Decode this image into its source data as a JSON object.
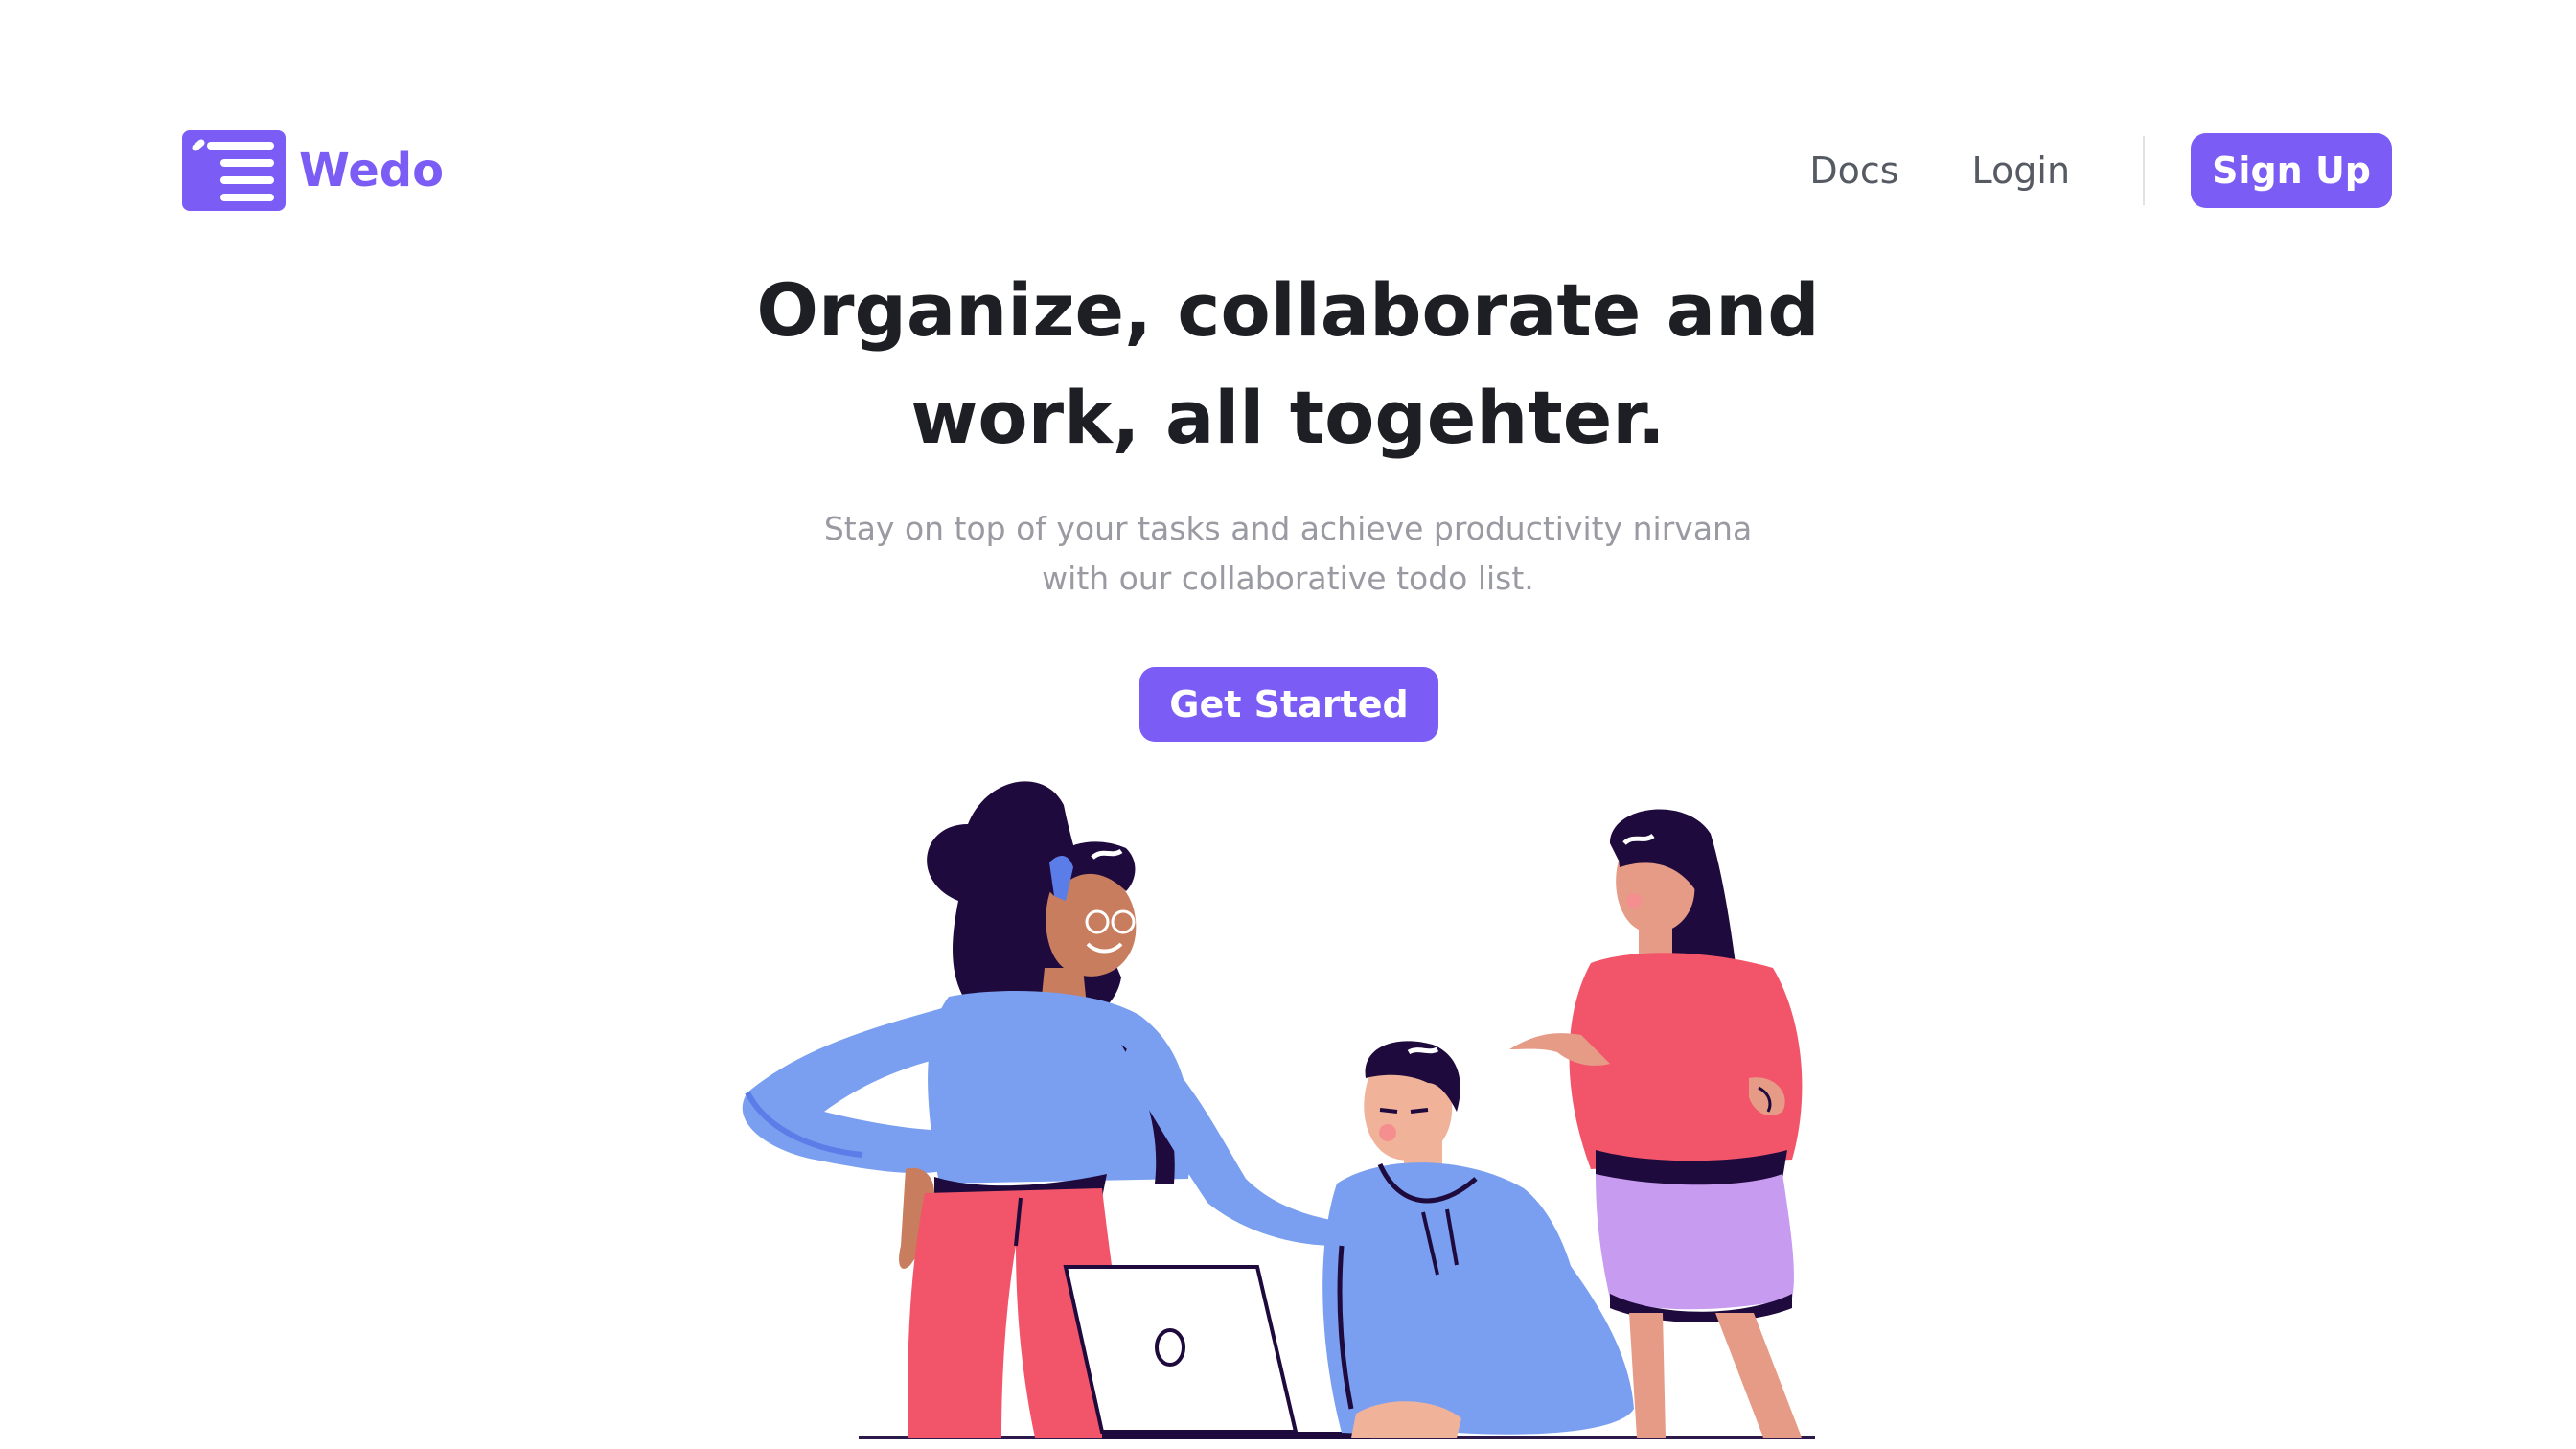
{
  "brand": {
    "name": "Wedo",
    "accent": "#7b5cf5"
  },
  "nav": {
    "docs": "Docs",
    "login": "Login",
    "signup": "Sign Up"
  },
  "hero": {
    "title_line1": "Organize, collaborate and",
    "title_line2": "work, all togehter.",
    "subtitle_line1": "Stay on top of your tasks and achieve productivity nirvana",
    "subtitle_line2": "with our collaborative todo list.",
    "cta": "Get Started"
  },
  "illustration": {
    "icon": "team-collaboration-illustration"
  }
}
